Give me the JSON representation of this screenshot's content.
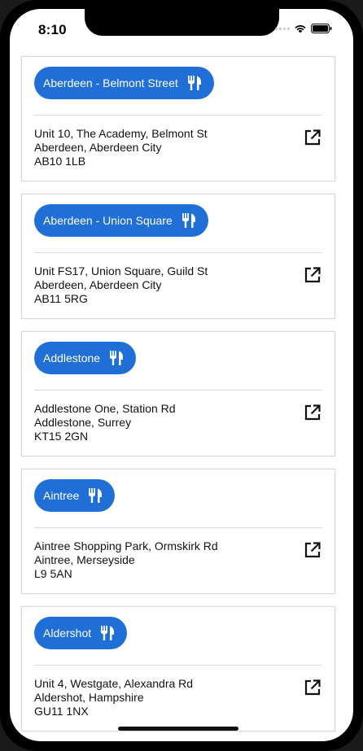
{
  "status_bar": {
    "time": "8:10"
  },
  "locations": [
    {
      "name": "Aberdeen - Belmont Street",
      "address": [
        "Unit 10, The Academy, Belmont St",
        "Aberdeen, Aberdeen City",
        "AB10 1LB"
      ],
      "icon": "restaurant-icon"
    },
    {
      "name": "Aberdeen - Union Square",
      "address": [
        "Unit FS17, Union Square, Guild St",
        "Aberdeen, Aberdeen City",
        "AB11 5RG"
      ],
      "icon": "restaurant-icon"
    },
    {
      "name": "Addlestone",
      "address": [
        "Addlestone One, Station Rd",
        "Addlestone, Surrey",
        "KT15 2GN"
      ],
      "icon": "restaurant-icon"
    },
    {
      "name": "Aintree",
      "address": [
        "Aintree Shopping Park, Ormskirk Rd",
        "Aintree, Merseyside",
        "L9 5AN"
      ],
      "icon": "restaurant-icon"
    },
    {
      "name": "Aldershot",
      "address": [
        "Unit 4, Westgate, Alexandra Rd",
        "Aldershot, Hampshire",
        "GU11 1NX"
      ],
      "icon": "restaurant-icon"
    }
  ],
  "colors": {
    "pill_bg": "#1f6fd6",
    "card_border": "#d9d9d9"
  }
}
